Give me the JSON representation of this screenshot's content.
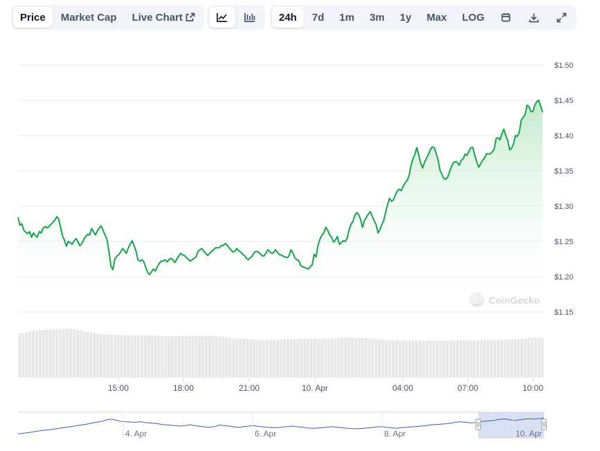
{
  "toolbar": {
    "view_tabs": [
      {
        "label": "Price",
        "active": true
      },
      {
        "label": "Market Cap",
        "active": false
      },
      {
        "label": "Live Chart",
        "active": false,
        "icon": "external-link-icon"
      }
    ],
    "chart_type_icons": [
      "line-chart-icon",
      "candlestick-chart-icon"
    ],
    "ranges": [
      {
        "label": "24h",
        "active": true
      },
      {
        "label": "7d",
        "active": false
      },
      {
        "label": "1m",
        "active": false
      },
      {
        "label": "3m",
        "active": false
      },
      {
        "label": "1y",
        "active": false
      },
      {
        "label": "Max",
        "active": false
      },
      {
        "label": "LOG",
        "active": false
      }
    ],
    "tool_icons": [
      "calendar-icon",
      "download-icon",
      "expand-icon"
    ]
  },
  "watermark": "CoinGecko",
  "colors": {
    "line": "#16a34a",
    "area_top": "#bfe9cb",
    "grid": "#e5e7eb",
    "volume": "#e8e8ea",
    "navigator_line": "#3b5bb5",
    "navigator_select": "#ccd5ee"
  },
  "chart_data": {
    "type": "line",
    "y_axis": {
      "ticks": [
        "$1.50",
        "$1.45",
        "$1.40",
        "$1.35",
        "$1.30",
        "$1.25",
        "$1.20",
        "$1.15"
      ],
      "range": [
        1.15,
        1.5
      ],
      "grid": true,
      "side": "right"
    },
    "x_axis": {
      "ticks": [
        "15:00",
        "18:00",
        "21:00",
        "10. Apr",
        "04:00",
        "07:00",
        "10:00"
      ]
    },
    "series": [
      {
        "values": [
          1.284,
          1.273,
          1.275,
          1.266,
          1.263,
          1.261,
          1.264,
          1.256,
          1.262,
          1.258,
          1.256,
          1.264,
          1.262,
          1.269,
          1.271,
          1.269,
          1.271,
          1.274,
          1.277,
          1.28,
          1.285,
          1.282,
          1.27,
          1.258,
          1.252,
          1.243,
          1.25,
          1.248,
          1.246,
          1.251,
          1.254,
          1.249,
          1.244,
          1.247,
          1.253,
          1.257,
          1.26,
          1.259,
          1.268,
          1.264,
          1.259,
          1.265,
          1.269,
          1.272,
          1.265,
          1.259,
          1.252,
          1.236,
          1.215,
          1.21,
          1.225,
          1.229,
          1.231,
          1.235,
          1.24,
          1.237,
          1.233,
          1.241,
          1.246,
          1.251,
          1.244,
          1.236,
          1.224,
          1.222,
          1.224,
          1.221,
          1.213,
          1.206,
          1.203,
          1.207,
          1.211,
          1.208,
          1.214,
          1.219,
          1.222,
          1.222,
          1.224,
          1.221,
          1.224,
          1.226,
          1.224,
          1.22,
          1.225,
          1.229,
          1.233,
          1.231,
          1.23,
          1.227,
          1.225,
          1.222,
          1.224,
          1.226,
          1.228,
          1.236,
          1.238,
          1.24,
          1.236,
          1.233,
          1.23,
          1.233,
          1.236,
          1.238,
          1.241,
          1.241,
          1.241,
          1.244,
          1.244,
          1.247,
          1.245,
          1.241,
          1.238,
          1.235,
          1.236,
          1.24,
          1.237,
          1.235,
          1.232,
          1.23,
          1.226,
          1.224,
          1.227,
          1.229,
          1.234,
          1.236,
          1.235,
          1.233,
          1.23,
          1.229,
          1.233,
          1.238,
          1.236,
          1.233,
          1.234,
          1.238,
          1.235,
          1.231,
          1.231,
          1.229,
          1.228,
          1.227,
          1.229,
          1.238,
          1.234,
          1.227,
          1.224,
          1.223,
          1.216,
          1.214,
          1.213,
          1.212,
          1.211,
          1.214,
          1.217,
          1.232,
          1.228,
          1.244,
          1.253,
          1.259,
          1.262,
          1.27,
          1.266,
          1.259,
          1.256,
          1.249,
          1.252,
          1.257,
          1.246,
          1.248,
          1.251,
          1.25,
          1.254,
          1.266,
          1.274,
          1.278,
          1.287,
          1.291,
          1.288,
          1.281,
          1.27,
          1.28,
          1.284,
          1.289,
          1.292,
          1.286,
          1.279,
          1.274,
          1.262,
          1.267,
          1.274,
          1.28,
          1.292,
          1.303,
          1.311,
          1.307,
          1.309,
          1.316,
          1.322,
          1.324,
          1.322,
          1.328,
          1.333,
          1.336,
          1.343,
          1.357,
          1.367,
          1.373,
          1.383,
          1.373,
          1.361,
          1.354,
          1.362,
          1.368,
          1.373,
          1.38,
          1.384,
          1.383,
          1.375,
          1.366,
          1.351,
          1.345,
          1.339,
          1.338,
          1.341,
          1.349,
          1.356,
          1.362,
          1.363,
          1.362,
          1.358,
          1.365,
          1.367,
          1.374,
          1.372,
          1.378,
          1.383,
          1.383,
          1.372,
          1.363,
          1.355,
          1.36,
          1.365,
          1.368,
          1.374,
          1.374,
          1.374,
          1.377,
          1.381,
          1.396,
          1.397,
          1.394,
          1.403,
          1.409,
          1.4,
          1.393,
          1.38,
          1.382,
          1.388,
          1.4,
          1.399,
          1.405,
          1.422,
          1.426,
          1.43,
          1.443,
          1.441,
          1.434,
          1.434,
          1.443,
          1.448,
          1.45,
          1.442,
          1.433
        ]
      }
    ],
    "volume": {
      "range": [
        0,
        1
      ],
      "values": [
        0.825,
        0.835,
        0.846,
        0.857,
        0.867,
        0.873,
        0.879,
        0.884,
        0.889,
        0.893,
        0.896,
        0.899,
        0.903,
        0.907,
        0.907,
        0.904,
        0.898,
        0.888,
        0.877,
        0.864,
        0.851,
        0.838,
        0.827,
        0.817,
        0.81,
        0.805,
        0.801,
        0.798,
        0.796,
        0.794,
        0.792,
        0.79,
        0.788,
        0.787,
        0.787,
        0.787,
        0.788,
        0.789,
        0.788,
        0.787,
        0.783,
        0.779,
        0.774,
        0.77,
        0.769,
        0.769,
        0.771,
        0.773,
        0.774,
        0.775,
        0.775,
        0.774,
        0.773,
        0.773,
        0.773,
        0.774,
        0.774,
        0.772,
        0.767,
        0.761,
        0.754,
        0.745,
        0.737,
        0.731,
        0.726,
        0.723,
        0.72,
        0.716,
        0.712,
        0.707,
        0.703,
        0.699,
        0.697,
        0.697,
        0.698,
        0.701,
        0.705,
        0.708,
        0.712,
        0.714,
        0.716,
        0.717,
        0.718,
        0.719,
        0.72,
        0.721,
        0.722,
        0.722,
        0.723,
        0.723,
        0.724,
        0.725,
        0.727,
        0.731,
        0.735,
        0.739,
        0.742,
        0.743,
        0.742,
        0.74,
        0.738,
        0.735,
        0.731,
        0.726,
        0.72,
        0.714,
        0.708,
        0.703,
        0.699,
        0.696,
        0.694,
        0.692,
        0.691,
        0.69,
        0.689,
        0.689,
        0.689,
        0.69,
        0.69,
        0.69,
        0.69,
        0.689,
        0.688,
        0.687,
        0.687,
        0.688,
        0.689,
        0.691,
        0.693,
        0.694,
        0.694,
        0.694,
        0.693,
        0.693,
        0.693,
        0.694,
        0.695,
        0.697,
        0.699,
        0.701,
        0.702,
        0.704,
        0.705,
        0.706,
        0.707,
        0.709,
        0.712,
        0.716,
        0.72,
        0.727,
        0.734,
        0.741,
        0.746,
        0.748,
        0.745
      ]
    },
    "navigator": {
      "x_ticks": [
        "4. Apr",
        "6. Apr",
        "8. Apr",
        "10. Apr"
      ],
      "values": [
        0.1,
        0.13,
        0.16,
        0.2,
        0.24,
        0.28,
        0.3,
        0.33,
        0.37,
        0.41,
        0.45,
        0.48,
        0.52,
        0.56,
        0.6,
        0.65,
        0.7,
        0.74,
        0.82,
        0.86,
        0.8,
        0.74,
        0.72,
        0.71,
        0.7,
        0.73,
        0.68,
        0.66,
        0.64,
        0.6,
        0.57,
        0.55,
        0.52,
        0.5,
        0.53,
        0.57,
        0.52,
        0.49,
        0.46,
        0.44,
        0.48,
        0.55,
        0.53,
        0.5,
        0.46,
        0.44,
        0.47,
        0.5,
        0.52,
        0.48,
        0.46,
        0.44,
        0.42,
        0.43,
        0.46,
        0.48,
        0.5,
        0.46,
        0.44,
        0.4,
        0.38,
        0.4,
        0.42,
        0.45,
        0.47,
        0.44,
        0.41,
        0.39,
        0.37,
        0.36,
        0.38,
        0.4,
        0.43,
        0.46,
        0.47,
        0.44,
        0.41,
        0.39,
        0.42,
        0.44,
        0.46,
        0.48,
        0.5,
        0.53,
        0.56,
        0.58,
        0.6,
        0.62,
        0.65,
        0.7,
        0.72,
        0.7,
        0.67,
        0.68,
        0.72,
        0.75,
        0.78,
        0.8,
        0.85,
        0.87,
        0.83,
        0.79,
        0.82,
        0.86,
        0.88,
        0.86,
        0.89,
        0.92
      ],
      "selected_range": [
        0.875,
        1.0
      ]
    }
  }
}
